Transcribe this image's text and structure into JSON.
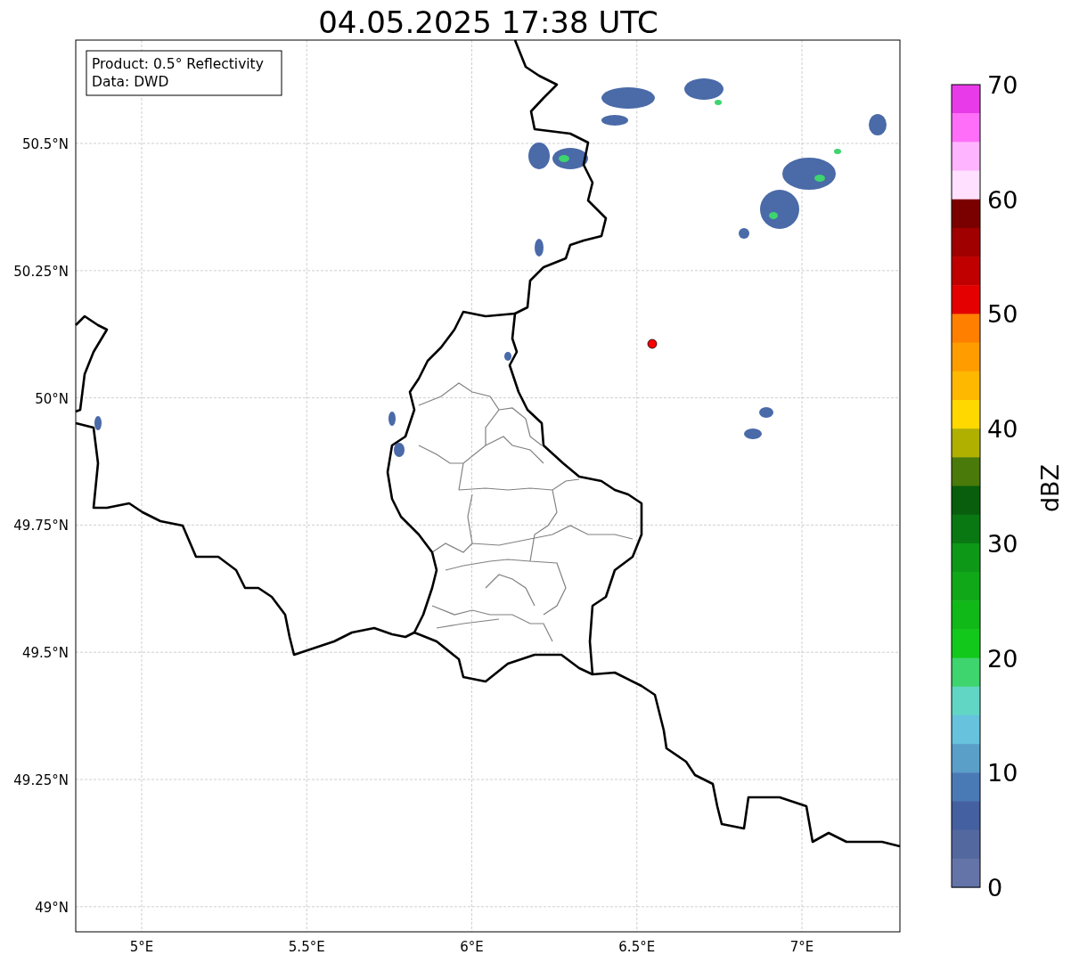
{
  "title": "04.05.2025 17:38 UTC",
  "info_box": [
    "Product: 0.5° Reflectivity",
    "Data: DWD"
  ],
  "map": {
    "lat_labels": [
      "50.5°N",
      "50.25°N",
      "50°N",
      "49.75°N",
      "49.5°N",
      "49.25°N",
      "49°N"
    ],
    "lon_labels": [
      "5°E",
      "5.5°E",
      "6°E",
      "6.5°E",
      "7°E"
    ]
  },
  "colorbar": {
    "label": "dBZ",
    "ticks": [
      "70",
      "60",
      "50",
      "40",
      "30",
      "20",
      "10",
      "0"
    ],
    "bands": [
      {
        "color": "#e83ae8"
      },
      {
        "color": "#ff6ef8"
      },
      {
        "color": "#ffb4ff"
      },
      {
        "color": "#ffe0ff"
      },
      {
        "color": "#7a0000"
      },
      {
        "color": "#a00000"
      },
      {
        "color": "#c00000"
      },
      {
        "color": "#e40000"
      },
      {
        "color": "#ff8000"
      },
      {
        "color": "#ff9c00"
      },
      {
        "color": "#ffb800"
      },
      {
        "color": "#ffd800"
      },
      {
        "color": "#b0b000"
      },
      {
        "color": "#4a7a0a"
      },
      {
        "color": "#085e0c"
      },
      {
        "color": "#0a7812"
      },
      {
        "color": "#0e9818"
      },
      {
        "color": "#10a818"
      },
      {
        "color": "#10b818"
      },
      {
        "color": "#12c81a"
      },
      {
        "color": "#3ed46e"
      },
      {
        "color": "#62d6c4"
      },
      {
        "color": "#66c2dd"
      },
      {
        "color": "#5a9fc8"
      },
      {
        "color": "#4a7ab5"
      },
      {
        "color": "#4560a0"
      },
      {
        "color": "#5468a0"
      },
      {
        "color": "#6574a8"
      }
    ]
  }
}
